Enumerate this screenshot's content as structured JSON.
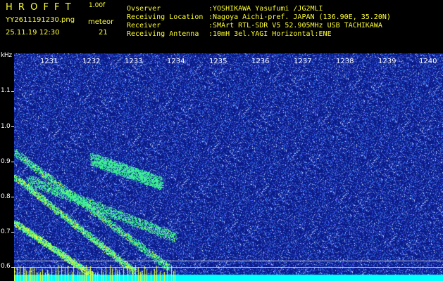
{
  "header": {
    "brand": "H R O F F T",
    "version": "1.00f",
    "filename": "YY2611191230.png",
    "mode": "meteor",
    "datetime": "25.11.19 12:30",
    "count": "21",
    "info_labels": [
      "Ovserver",
      "Receiving Location",
      "Receiver",
      "Receiving Antenna"
    ],
    "info_values": [
      ":YOSHIKAWA Yasufumi /JG2MLI",
      ":Nagoya Aichi-pref. JAPAN (136.90E, 35.20N)",
      ":SMArt RTL-SDR V5 52.905MHz USB TACHIKAWA",
      ":10mH 3el.YAGI Horizontal:ENE"
    ]
  },
  "axis": {
    "unit": "kHz",
    "y_ticks": [
      "1.1",
      "1.0",
      "0.9",
      "0.8",
      "0.7",
      "0.6"
    ],
    "x_ticks": [
      "1231",
      "1232",
      "1233",
      "1234",
      "1235",
      "1236",
      "1237",
      "1238",
      "1239",
      "1240"
    ]
  },
  "colors": {
    "background": "#000000",
    "spectrum_base": "#0b1c8a",
    "noise": "#8fb0ff",
    "trail": "#3cff5a",
    "trail_hot": "#eaff3a",
    "bottom_band": "#00ffff",
    "header_text": "#ffff33"
  }
}
